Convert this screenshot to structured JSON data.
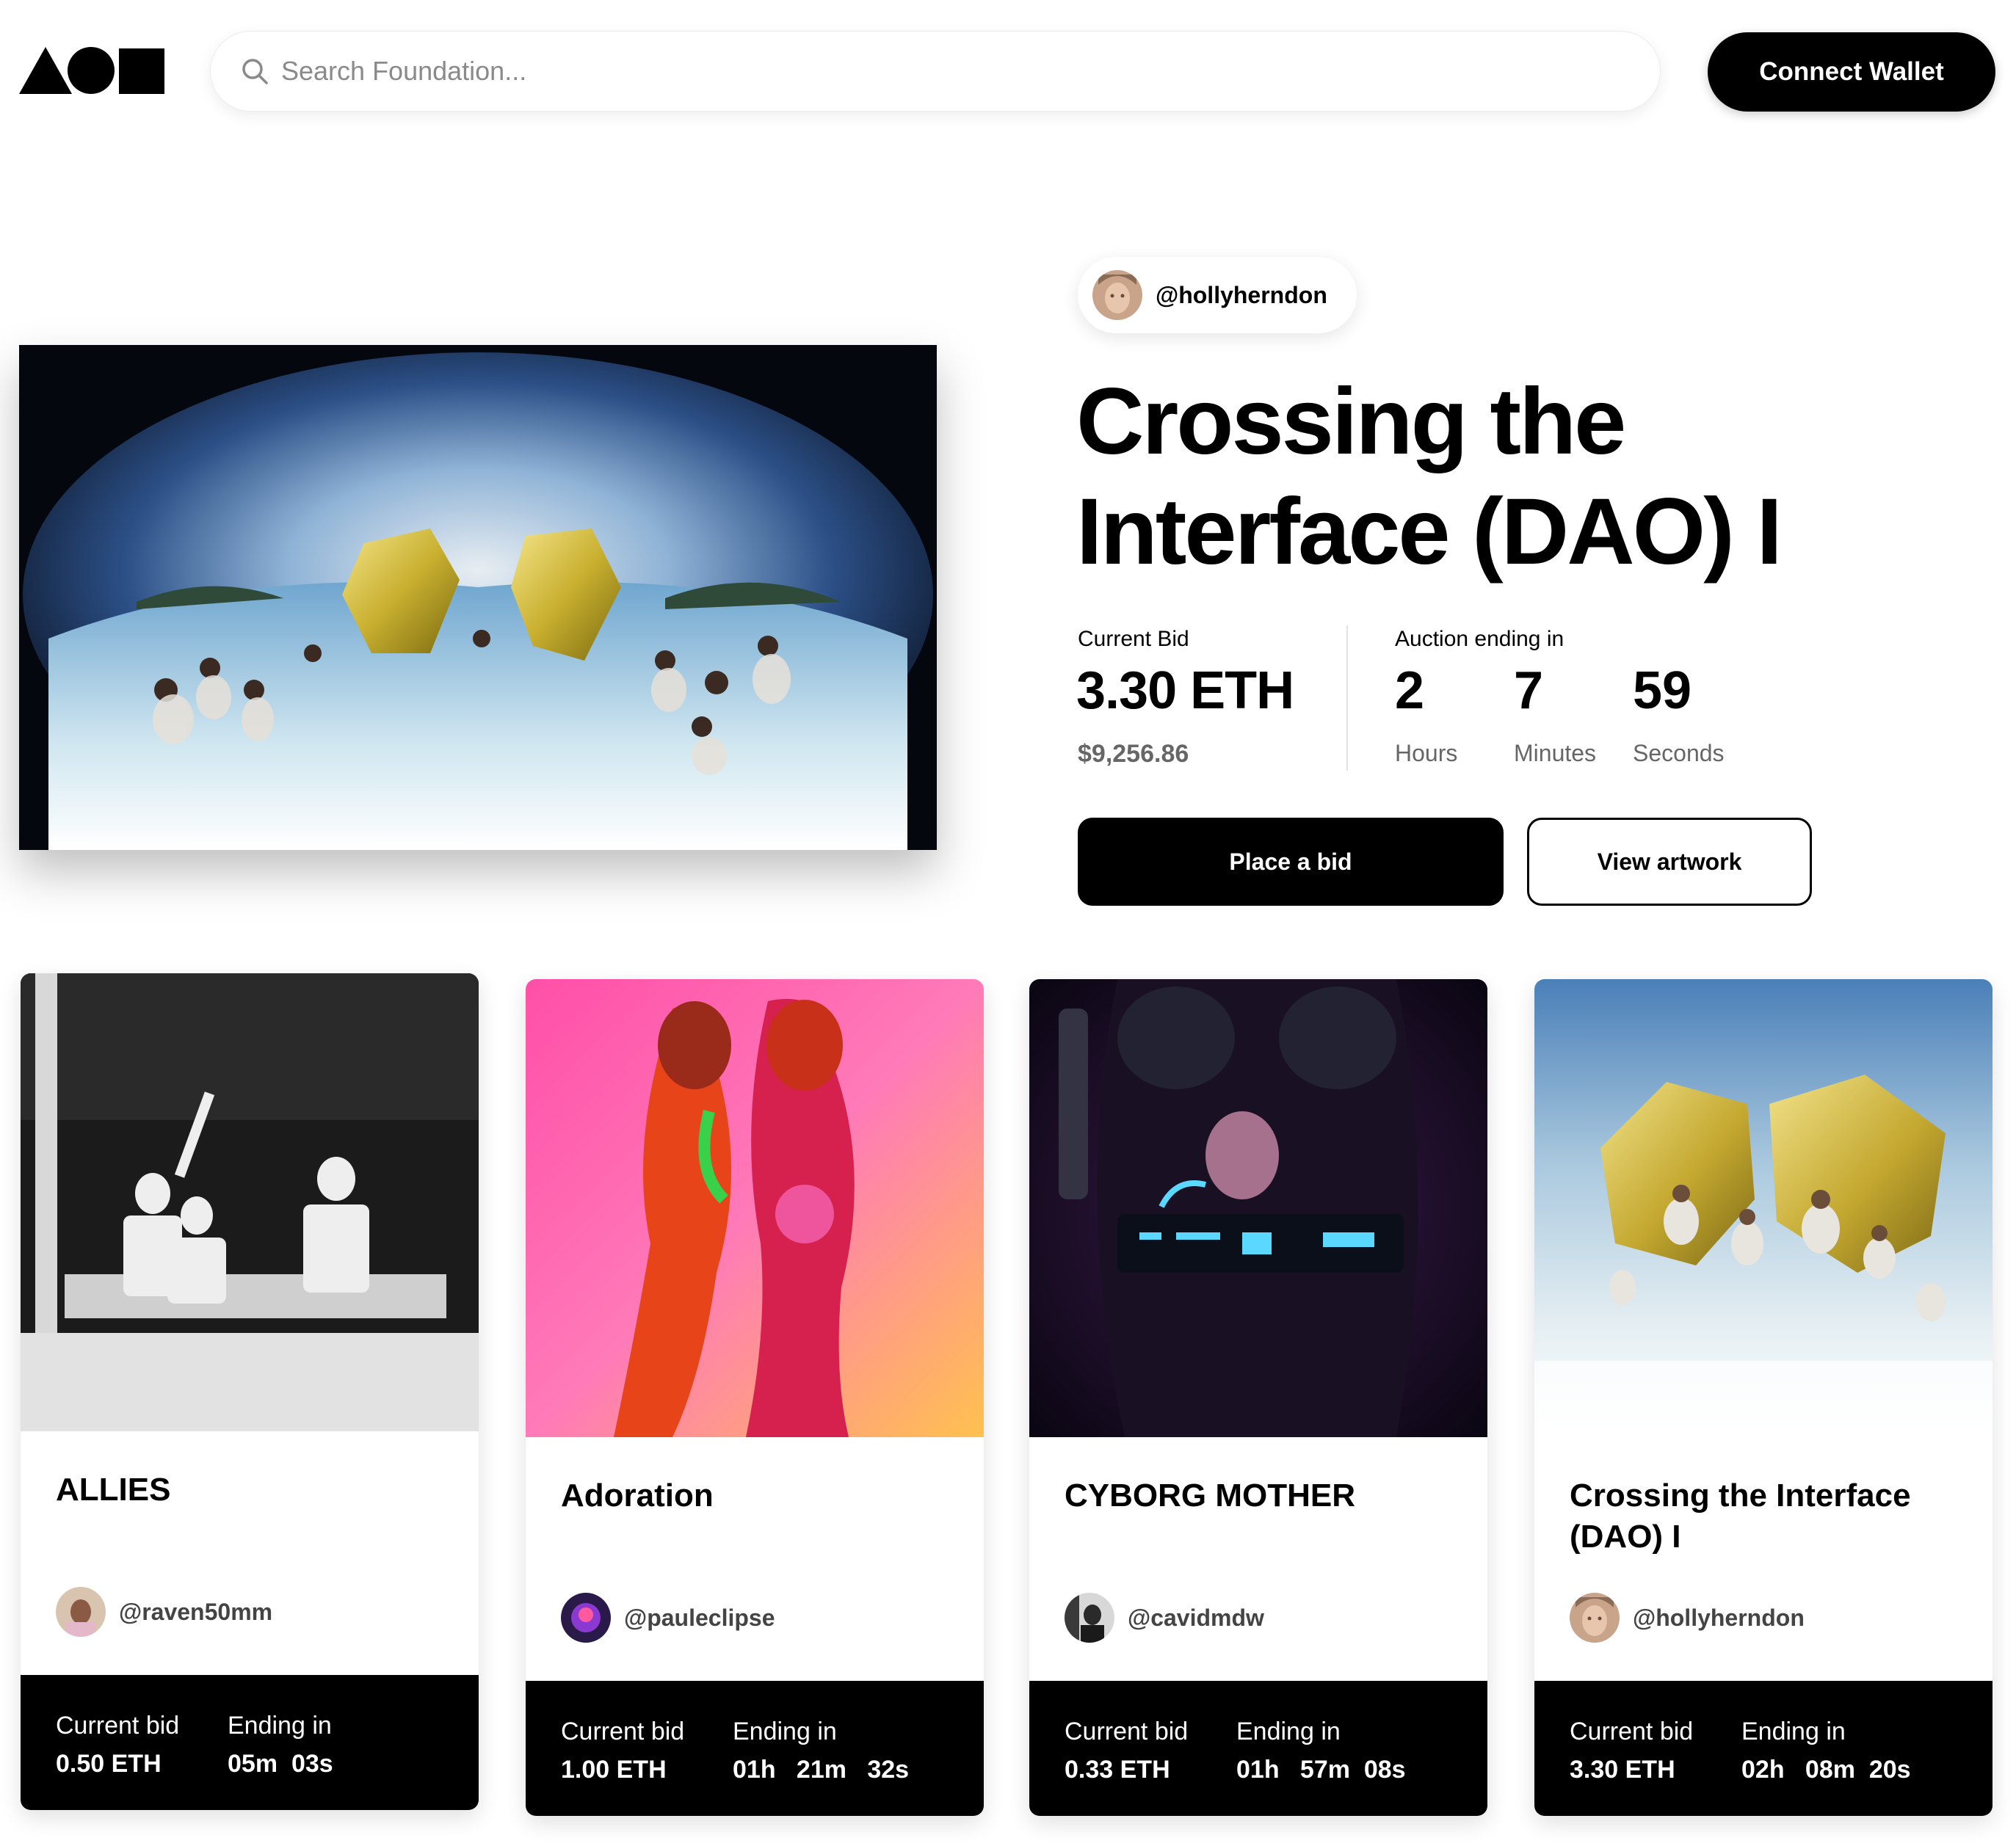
{
  "header": {
    "search_placeholder": "Search Foundation...",
    "connect_label": "Connect Wallet"
  },
  "hero": {
    "creator": "@hollyherndon",
    "title": "Crossing the Interface (DAO) I",
    "current_bid_label": "Current Bid",
    "current_bid": "3.30 ETH",
    "current_bid_usd": "$9,256.86",
    "auction_label": "Auction ending in",
    "countdown": [
      {
        "value": "2",
        "unit": "Hours"
      },
      {
        "value": "7",
        "unit": "Minutes"
      },
      {
        "value": "59",
        "unit": "Seconds"
      }
    ],
    "place_bid_label": "Place a bid",
    "view_artwork_label": "View artwork"
  },
  "cards": [
    {
      "title": "ALLIES",
      "creator": "@raven50mm",
      "bid_label": "Current bid",
      "bid": "0.50 ETH",
      "ending_label": "Ending in",
      "ending": "05m  03s"
    },
    {
      "title": "Adoration",
      "creator": "@pauleclipse",
      "bid_label": "Current bid",
      "bid": "1.00 ETH",
      "ending_label": "Ending in",
      "ending": "01h   21m   32s"
    },
    {
      "title": "CYBORG MOTHER",
      "creator": "@cavidmdw",
      "bid_label": "Current bid",
      "bid": "0.33 ETH",
      "ending_label": "Ending in",
      "ending": "01h   57m  08s"
    },
    {
      "title": "Crossing the Interface (DAO) I",
      "creator": "@hollyherndon",
      "bid_label": "Current bid",
      "bid": "3.30 ETH",
      "ending_label": "Ending in",
      "ending": "02h   08m  20s"
    }
  ],
  "icons": {
    "logo": "foundation-logo-triangle-circle-square",
    "search": "search-icon"
  },
  "colors": {
    "primary": "#000000",
    "background": "#ffffff",
    "muted_text": "#666666"
  }
}
